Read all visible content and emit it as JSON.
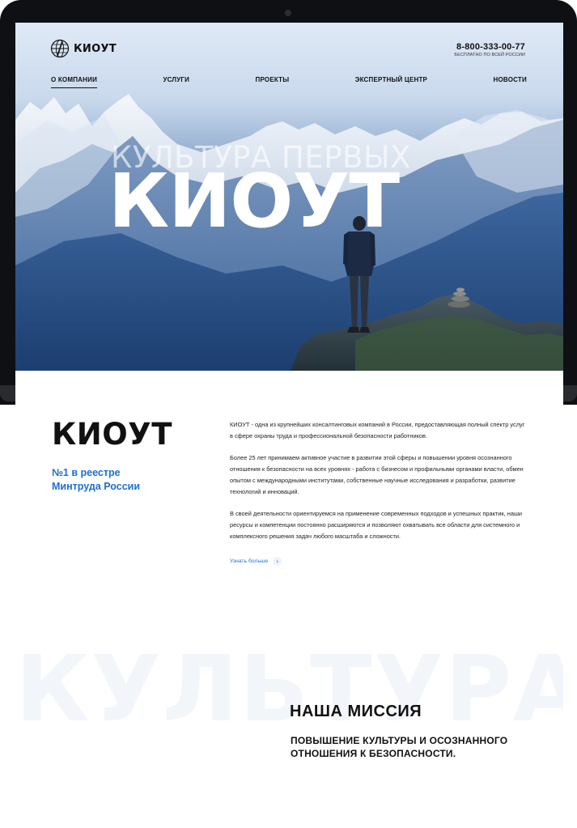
{
  "brand": {
    "name": "КИОУТ"
  },
  "header": {
    "phone": "8-800-333-00-77",
    "phone_note": "БЕСПЛАТНО ПО ВСЕЙ РОССИИ"
  },
  "nav": {
    "items": [
      {
        "label": "О КОМПАНИИ",
        "active": true
      },
      {
        "label": "УСЛУГИ",
        "active": false
      },
      {
        "label": "ПРОЕКТЫ",
        "active": false
      },
      {
        "label": "ЭКСПЕРТНЫЙ ЦЕНТР",
        "active": false
      },
      {
        "label": "НОВОСТИ",
        "active": false
      }
    ]
  },
  "hero": {
    "subtitle": "КУЛЬТУРА ПЕРВЫХ",
    "title": "КИОУТ"
  },
  "about": {
    "title": "КИОУТ",
    "badge_line1": "№1 в реестре",
    "badge_line2": "Минтруда России",
    "paragraphs": [
      "КИОУТ - одна из крупнейших консалтинговых компаний в России, предоставляющая полный спектр услуг в сфере охраны труда и профессиональной безопасности работников.",
      "Более 25 лет принимаем активное участие в развитии этой сферы и повышении уровня осознанного отношения к безопасности на всех уровнях  -  работа с бизнесом и профильными органами власти, обмен опытом с международными институтами, собственные научные исследования и разработки, развитие технологий и инноваций.",
      "В своей деятельности ориентируемся на применение современных подходов и успешных практик, наши ресурсы и компетенции постоянно расширяются и позволяют охватывать все области для  системного и комплексного решения задач любого масштаба и сложности."
    ],
    "more_label": "Узнать больше",
    "more_icon": "chevron-right-icon"
  },
  "mission": {
    "background_word": "КУЛЬТУРА",
    "title": "НАША МИССИЯ",
    "text_line1": "ПОВЫШЕНИЕ КУЛЬТУРЫ И ОСОЗНАННОГО",
    "text_line2": "ОТНОШЕНИЯ К БЕЗОПАСНОСТИ."
  },
  "colors": {
    "accent": "#1d6fd1",
    "text": "#111111",
    "frame": "#0f1013"
  }
}
